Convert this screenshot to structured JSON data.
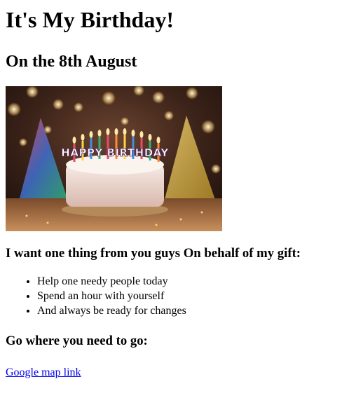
{
  "heading": "It's My Birthday!",
  "subheading": "On the 8th August",
  "image": {
    "overlay_text": "HAPPY BIRTHDAY"
  },
  "request_heading": "I want one thing from you guys On behalf of my gift:",
  "gift_list": [
    "Help one needy people today",
    "Spend an hour with yourself",
    "And always be ready for changes"
  ],
  "directions_heading": "Go where you need to go:",
  "map_link": "Google map link",
  "colors": {
    "link": "#0000ee",
    "text": "#000000",
    "background": "#ffffff"
  }
}
